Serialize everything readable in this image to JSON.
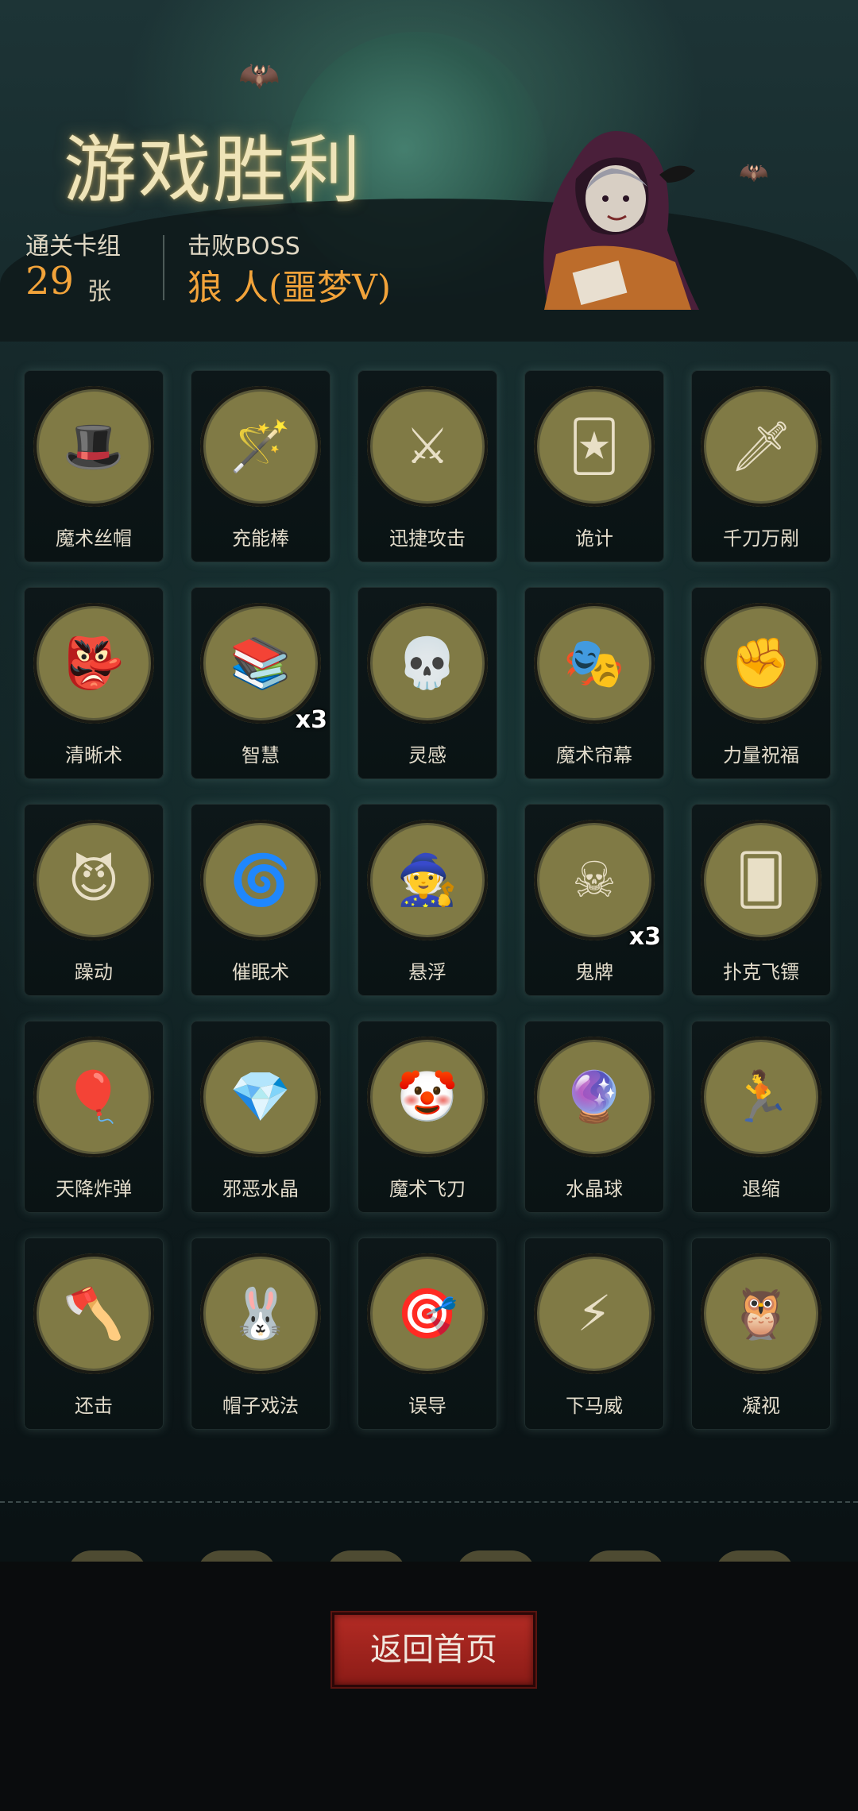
{
  "header": {
    "title": "游戏胜利",
    "deck_label": "通关卡组",
    "deck_count": "29",
    "deck_unit": "张",
    "boss_label": "击败BOSS",
    "boss_name": "狼 人(噩梦V)"
  },
  "cards": [
    {
      "name": "魔术丝帽",
      "icon": "top-hat-icon",
      "glyph": "🎩",
      "multiplier": ""
    },
    {
      "name": "充能棒",
      "icon": "wand-icon",
      "glyph": "🪄",
      "multiplier": ""
    },
    {
      "name": "迅捷攻击",
      "icon": "swift-strike-icon",
      "glyph": "⚔",
      "multiplier": ""
    },
    {
      "name": "诡计",
      "icon": "trick-icon",
      "glyph": "🃏",
      "multiplier": ""
    },
    {
      "name": "千刀万剐",
      "icon": "thousand-blades-icon",
      "glyph": "🗡",
      "multiplier": ""
    },
    {
      "name": "清晰术",
      "icon": "goblin-clarity-icon",
      "glyph": "👺",
      "multiplier": ""
    },
    {
      "name": "智慧",
      "icon": "wisdom-icon",
      "glyph": "📚",
      "multiplier": "x3"
    },
    {
      "name": "灵感",
      "icon": "inspiration-skull-icon",
      "glyph": "💀",
      "multiplier": ""
    },
    {
      "name": "魔术帘幕",
      "icon": "magic-curtain-icon",
      "glyph": "🎭",
      "multiplier": ""
    },
    {
      "name": "力量祝福",
      "icon": "fist-icon",
      "glyph": "✊",
      "multiplier": ""
    },
    {
      "name": "躁动",
      "icon": "frenzy-icon",
      "glyph": "😈",
      "multiplier": ""
    },
    {
      "name": "催眠术",
      "icon": "hypnosis-icon",
      "glyph": "🌀",
      "multiplier": ""
    },
    {
      "name": "悬浮",
      "icon": "levitate-icon",
      "glyph": "🧙",
      "multiplier": ""
    },
    {
      "name": "鬼牌",
      "icon": "ghost-card-icon",
      "glyph": "☠",
      "multiplier": "x3"
    },
    {
      "name": "扑克飞镖",
      "icon": "poker-dart-icon",
      "glyph": "🂠",
      "multiplier": ""
    },
    {
      "name": "天降炸弹",
      "icon": "balloon-bomb-icon",
      "glyph": "🎈",
      "multiplier": ""
    },
    {
      "name": "邪恶水晶",
      "icon": "evil-crystal-icon",
      "glyph": "💎",
      "multiplier": ""
    },
    {
      "name": "魔术飞刀",
      "icon": "clown-knives-icon",
      "glyph": "🤡",
      "multiplier": ""
    },
    {
      "name": "水晶球",
      "icon": "crystal-ball-icon",
      "glyph": "🔮",
      "multiplier": ""
    },
    {
      "name": "退缩",
      "icon": "retreat-icon",
      "glyph": "🏃",
      "multiplier": ""
    },
    {
      "name": "还击",
      "icon": "counterattack-icon",
      "glyph": "🪓",
      "multiplier": ""
    },
    {
      "name": "帽子戏法",
      "icon": "rabbit-hat-icon",
      "glyph": "🐰",
      "multiplier": ""
    },
    {
      "name": "误导",
      "icon": "mislead-skull-icon",
      "glyph": "🎯",
      "multiplier": ""
    },
    {
      "name": "下马威",
      "icon": "intimidate-icon",
      "glyph": "⚡",
      "multiplier": ""
    },
    {
      "name": "凝视",
      "icon": "owl-gaze-icon",
      "glyph": "🦉",
      "multiplier": ""
    }
  ],
  "footer": {
    "return_label": "返回首页"
  },
  "colors": {
    "accent": "#f2a33a",
    "button": "#a8241e"
  }
}
